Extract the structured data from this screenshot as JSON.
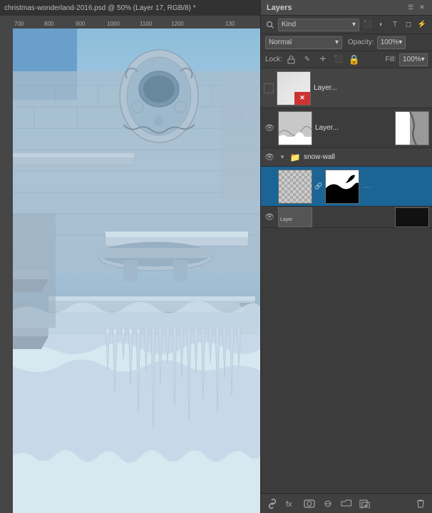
{
  "titleBar": {
    "text": "christmas-wonderland-2016.psd @ 50% (Layer 17, RGB/8) *"
  },
  "ruler": {
    "marks": [
      "700",
      "800",
      "900",
      "1000",
      "1100",
      "1200",
      "130"
    ]
  },
  "panel": {
    "title": "Layers",
    "kindLabel": "Kind",
    "blendMode": "Normal",
    "opacityLabel": "Opacity:",
    "opacityValue": "100%",
    "lockLabel": "Lock:",
    "fillLabel": "Fill:",
    "fillValue": "100%",
    "layers": [
      {
        "id": "layer-top",
        "name": "Lay...",
        "visible": false,
        "hasRedX": true,
        "hasMask": true
      },
      {
        "id": "layer-2",
        "name": "Layer...",
        "visible": true,
        "hasRedX": false,
        "hasMask": true
      },
      {
        "id": "snow-wall-group",
        "type": "group",
        "name": "snow-wall",
        "expanded": true,
        "visible": true
      },
      {
        "id": "layer-snowwall",
        "name": "",
        "visible": true,
        "hasRedX": false,
        "hasMask": true,
        "isChild": true
      },
      {
        "id": "layer-partial",
        "name": "",
        "visible": true,
        "isPartial": true
      }
    ],
    "toolbar": {
      "linkLabel": "link",
      "fxLabel": "fx",
      "maskLabel": "mask",
      "adjustLabel": "adjust",
      "groupLabel": "group",
      "newLabel": "new",
      "deleteLabel": "delete"
    }
  }
}
